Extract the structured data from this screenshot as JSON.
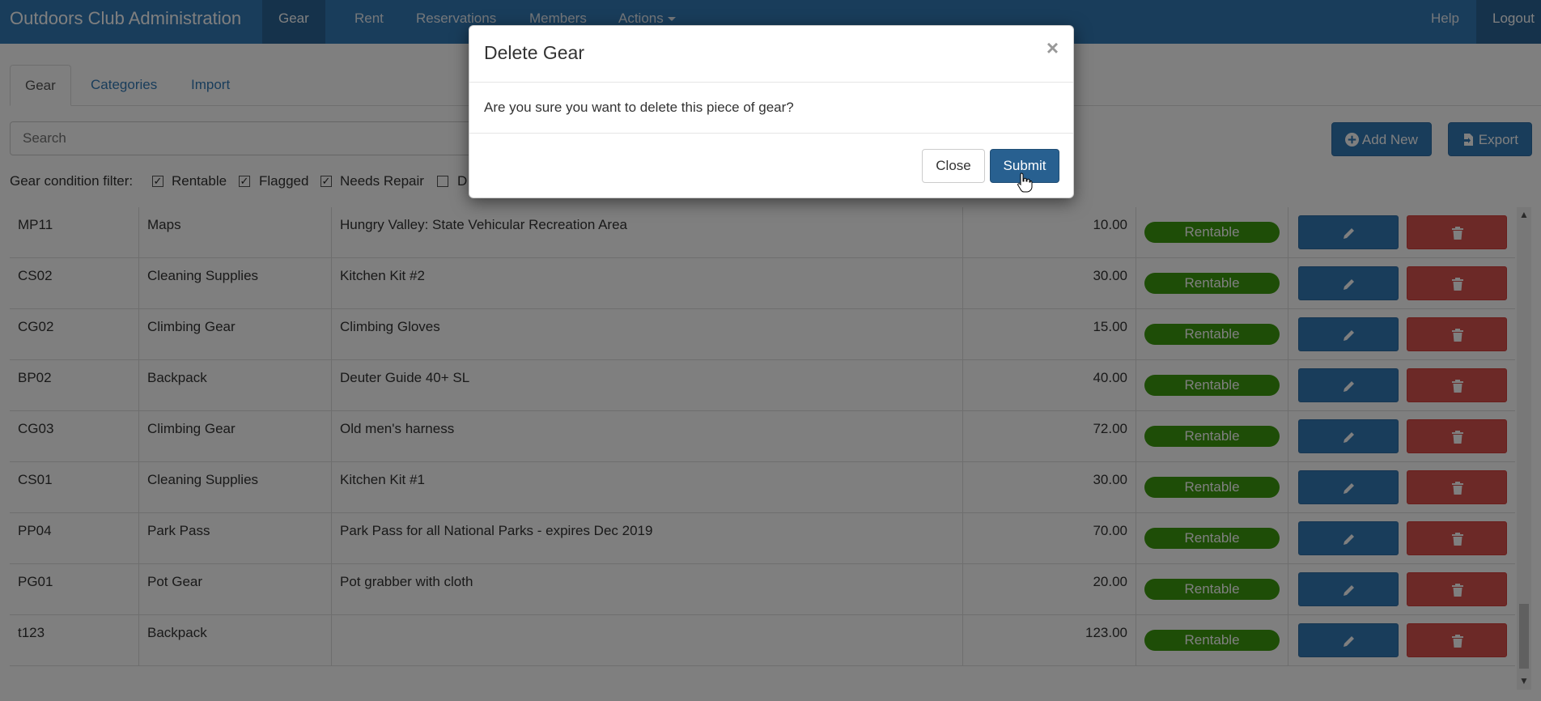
{
  "navbar": {
    "brand": "Outdoors Club Administration",
    "items": [
      {
        "label": "Gear",
        "active": true
      },
      {
        "label": "Rent"
      },
      {
        "label": "Reservations"
      },
      {
        "label": "Members"
      },
      {
        "label": "Actions"
      }
    ],
    "right_items": [
      {
        "label": "Help"
      },
      {
        "label": "Logout"
      }
    ]
  },
  "tabs": [
    {
      "label": "Gear",
      "active": true
    },
    {
      "label": "Categories"
    },
    {
      "label": "Import"
    }
  ],
  "search": {
    "placeholder": "Search"
  },
  "toolbar": {
    "add_label": "Add New",
    "export_label": "Export"
  },
  "filter": {
    "label": "Gear condition filter:",
    "options": [
      {
        "label": "Rentable",
        "checked": true
      },
      {
        "label": "Flagged",
        "checked": true
      },
      {
        "label": "Needs Repair",
        "checked": true
      },
      {
        "label": "D",
        "checked": false
      }
    ]
  },
  "table": {
    "rows": [
      {
        "code": "MP11",
        "category": "Maps",
        "description": "Hungry Valley: State Vehicular Recreation Area",
        "price": "10.00",
        "status": "Rentable"
      },
      {
        "code": "CS02",
        "category": "Cleaning Supplies",
        "description": "Kitchen Kit #2",
        "price": "30.00",
        "status": "Rentable"
      },
      {
        "code": "CG02",
        "category": "Climbing Gear",
        "description": "Climbing Gloves",
        "price": "15.00",
        "status": "Rentable"
      },
      {
        "code": "BP02",
        "category": "Backpack",
        "description": "Deuter Guide 40+ SL",
        "price": "40.00",
        "status": "Rentable"
      },
      {
        "code": "CG03",
        "category": "Climbing Gear",
        "description": "Old men's harness",
        "price": "72.00",
        "status": "Rentable"
      },
      {
        "code": "CS01",
        "category": "Cleaning Supplies",
        "description": "Kitchen Kit #1",
        "price": "30.00",
        "status": "Rentable"
      },
      {
        "code": "PP04",
        "category": "Park Pass",
        "description": "Park Pass for all National Parks - expires Dec 2019",
        "price": "70.00",
        "status": "Rentable"
      },
      {
        "code": "PG01",
        "category": "Pot Gear",
        "description": "Pot grabber with cloth",
        "price": "20.00",
        "status": "Rentable"
      },
      {
        "code": "t123",
        "category": "Backpack",
        "description": "",
        "price": "123.00",
        "status": "Rentable"
      }
    ]
  },
  "modal": {
    "title": "Delete Gear",
    "close_symbol": "×",
    "body": "Are you sure you want to delete this piece of gear?",
    "close_label": "Close",
    "submit_label": "Submit"
  },
  "colors": {
    "primary": "#337ab7",
    "danger": "#d9534f",
    "success": "#3c9a0e"
  }
}
